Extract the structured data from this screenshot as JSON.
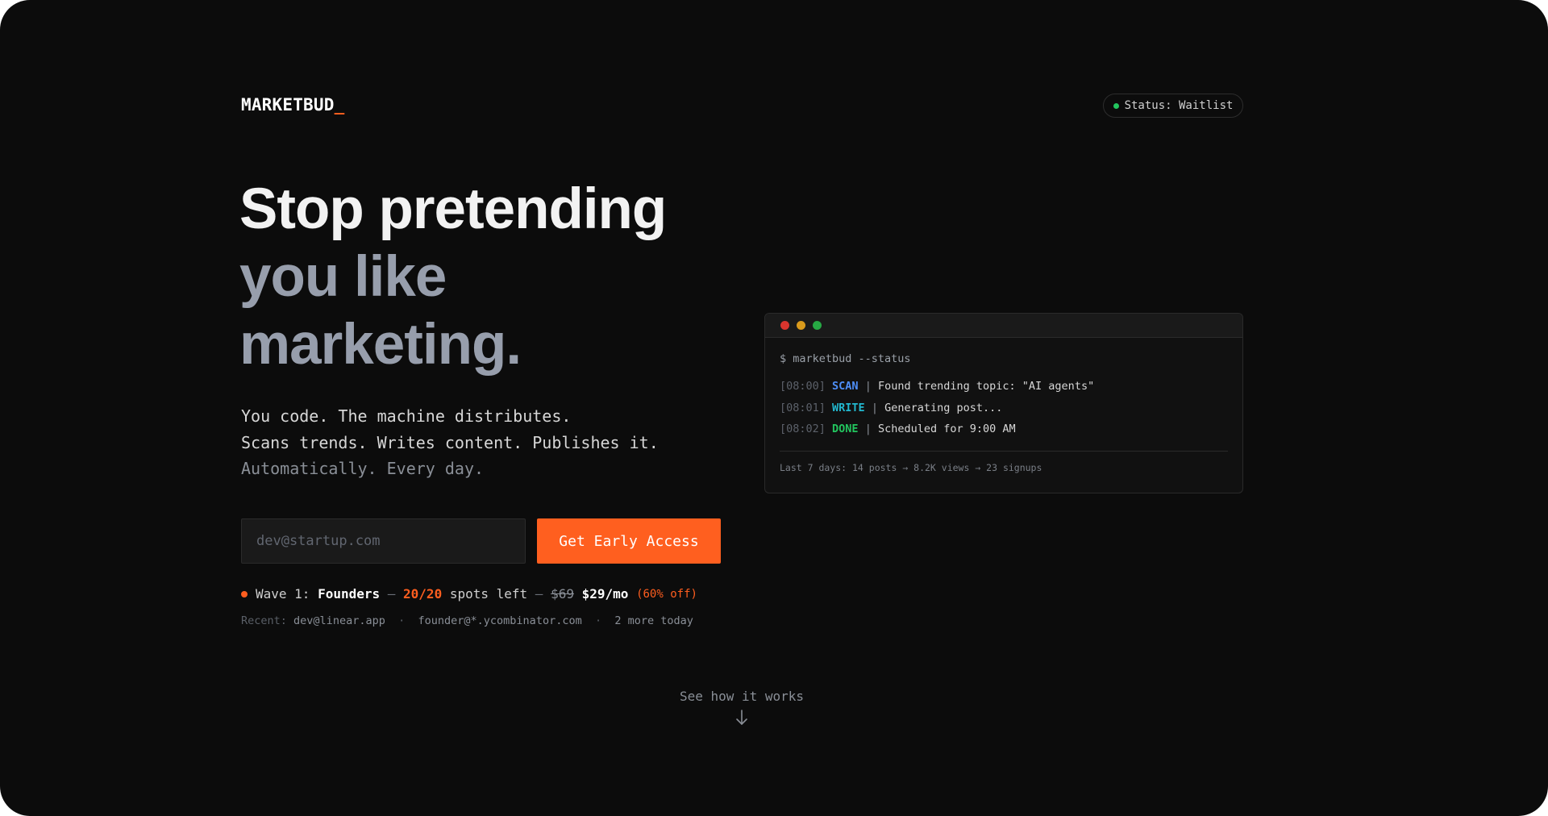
{
  "header": {
    "logo": "MARKETBUD",
    "logo_cursor": "_",
    "status": "Status: Waitlist"
  },
  "hero": {
    "line1": "Stop pretending",
    "line2": "you like",
    "line3": "marketing.",
    "sub1": "You code. The machine distributes.",
    "sub2": "Scans trends. Writes content. Publishes it.",
    "sub3": "Automatically. Every day."
  },
  "form": {
    "email_placeholder": "dev@startup.com",
    "cta_label": "Get Early Access"
  },
  "wave": {
    "prefix": "Wave 1: ",
    "tier": "Founders",
    "dash1": " — ",
    "spots": "20/20",
    "spots_suffix": " spots left",
    "dash2": " — ",
    "old_price": "$69",
    "price": "$29/mo",
    "discount": "(60% off)"
  },
  "recent": {
    "label": "Recent:",
    "item1": "dev@linear.app",
    "sep": "·",
    "item2": "founder@*.ycombinator.com",
    "item3": "2 more today"
  },
  "terminal": {
    "command": "$ marketbud --status",
    "logs": [
      {
        "time": "[08:00]",
        "tag": "SCAN",
        "message": "Found trending topic: \"AI agents\""
      },
      {
        "time": "[08:01]",
        "tag": "WRITE",
        "message": "Generating post..."
      },
      {
        "time": "[08:02]",
        "tag": "DONE",
        "message": "Scheduled for 9:00 AM"
      }
    ],
    "pipe": "|",
    "footer": "Last 7 days: 14 posts → 8.2K views → 23 signups"
  },
  "cta_more": {
    "label": "See how it works",
    "icon": "arrow-down-icon"
  },
  "colors": {
    "accent": "#ff5f1f",
    "background": "#0c0c0c",
    "status_green": "#22c55e",
    "scan_blue": "#4e8ef7",
    "write_cyan": "#22b8cf",
    "done_green": "#22c55e"
  }
}
